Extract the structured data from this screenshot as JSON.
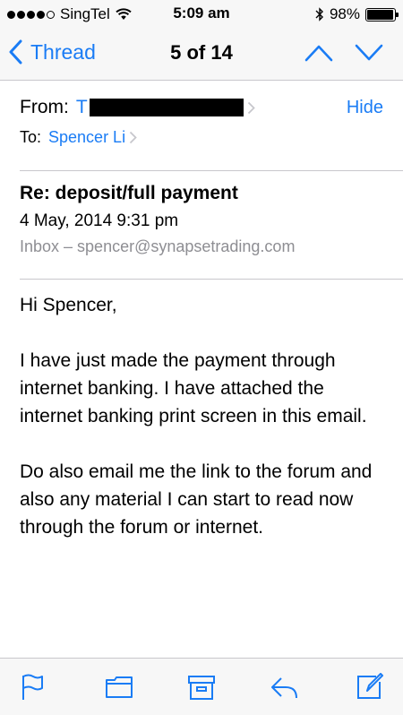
{
  "status_bar": {
    "carrier": "SingTel",
    "time": "5:09 am",
    "battery": "98%",
    "battery_level": 0.98
  },
  "nav": {
    "back_label": "Thread",
    "position": "5 of 14",
    "icons": [
      "chevron-left-icon",
      "chevron-up-icon",
      "chevron-down-icon"
    ]
  },
  "header": {
    "from_label": "From:",
    "from_name_visible": "T",
    "hide_label": "Hide",
    "to_label": "To:",
    "to_name": "Spencer Li",
    "subject": "Re: deposit/full payment",
    "date": "4 May, 2014 9:31 pm",
    "mailbox": "Inbox – spencer@synapsetrading.com"
  },
  "body": {
    "paragraphs": [
      "Hi Spencer,",
      "I have just made the payment through internet banking. I have attached the internet banking print screen in this email.",
      "Do also email me the link to the forum and also any material I can start to read now through the forum or internet."
    ]
  },
  "toolbar": {
    "icons": [
      "flag-icon",
      "folder-icon",
      "archive-icon",
      "reply-icon",
      "compose-icon"
    ]
  },
  "colors": {
    "accent": "#1a7cf5",
    "secondary_text": "#8e8e93",
    "separator": "#c8c7cc",
    "bar_background": "#f7f7f7"
  }
}
